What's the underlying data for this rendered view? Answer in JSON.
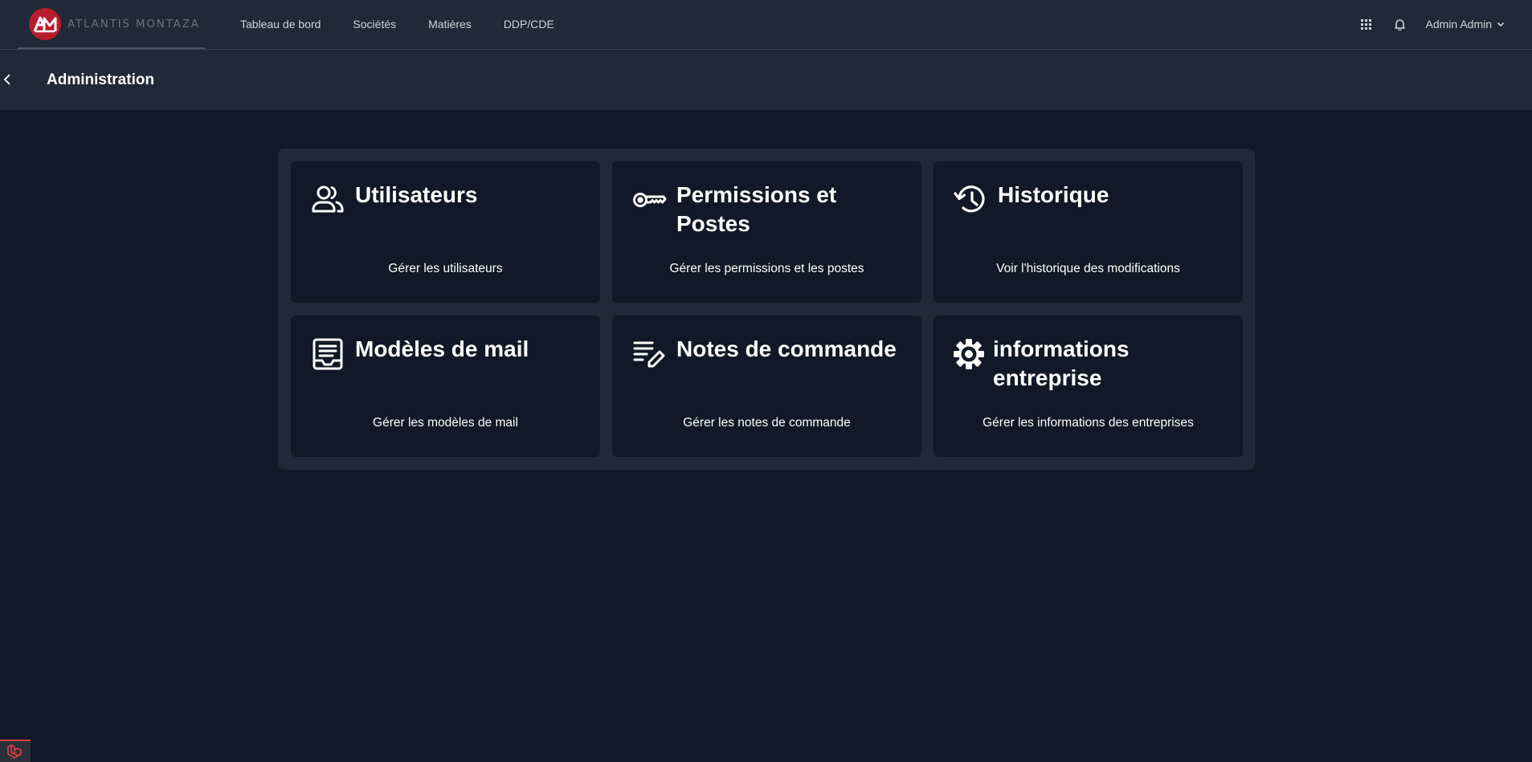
{
  "brand": {
    "name": "ATLANTIS MONTAZA"
  },
  "nav": [
    {
      "label": "Tableau de bord"
    },
    {
      "label": "Sociétés"
    },
    {
      "label": "Matières"
    },
    {
      "label": "DDP/CDE"
    }
  ],
  "user": {
    "name": "Admin Admin"
  },
  "header": {
    "title": "Administration"
  },
  "cards": [
    {
      "title": "Utilisateurs",
      "description": "Gérer les utilisateurs",
      "icon": "users-icon"
    },
    {
      "title": "Permissions et Postes",
      "description": "Gérer les permissions et les postes",
      "icon": "key-icon"
    },
    {
      "title": "Historique",
      "description": "Voir l'historique des modifications",
      "icon": "history-icon"
    },
    {
      "title": "Modèles de mail",
      "description": "Gérer les modèles de mail",
      "icon": "mail-template-icon"
    },
    {
      "title": "Notes de commande",
      "description": "Gérer les notes de commande",
      "icon": "notes-edit-icon"
    },
    {
      "title": "informations entreprise",
      "description": "Gérer les informations des entreprises",
      "icon": "gear-icon"
    }
  ],
  "colors": {
    "background": "#111827",
    "surface": "#1f2937",
    "brand": "#b91c2c"
  }
}
